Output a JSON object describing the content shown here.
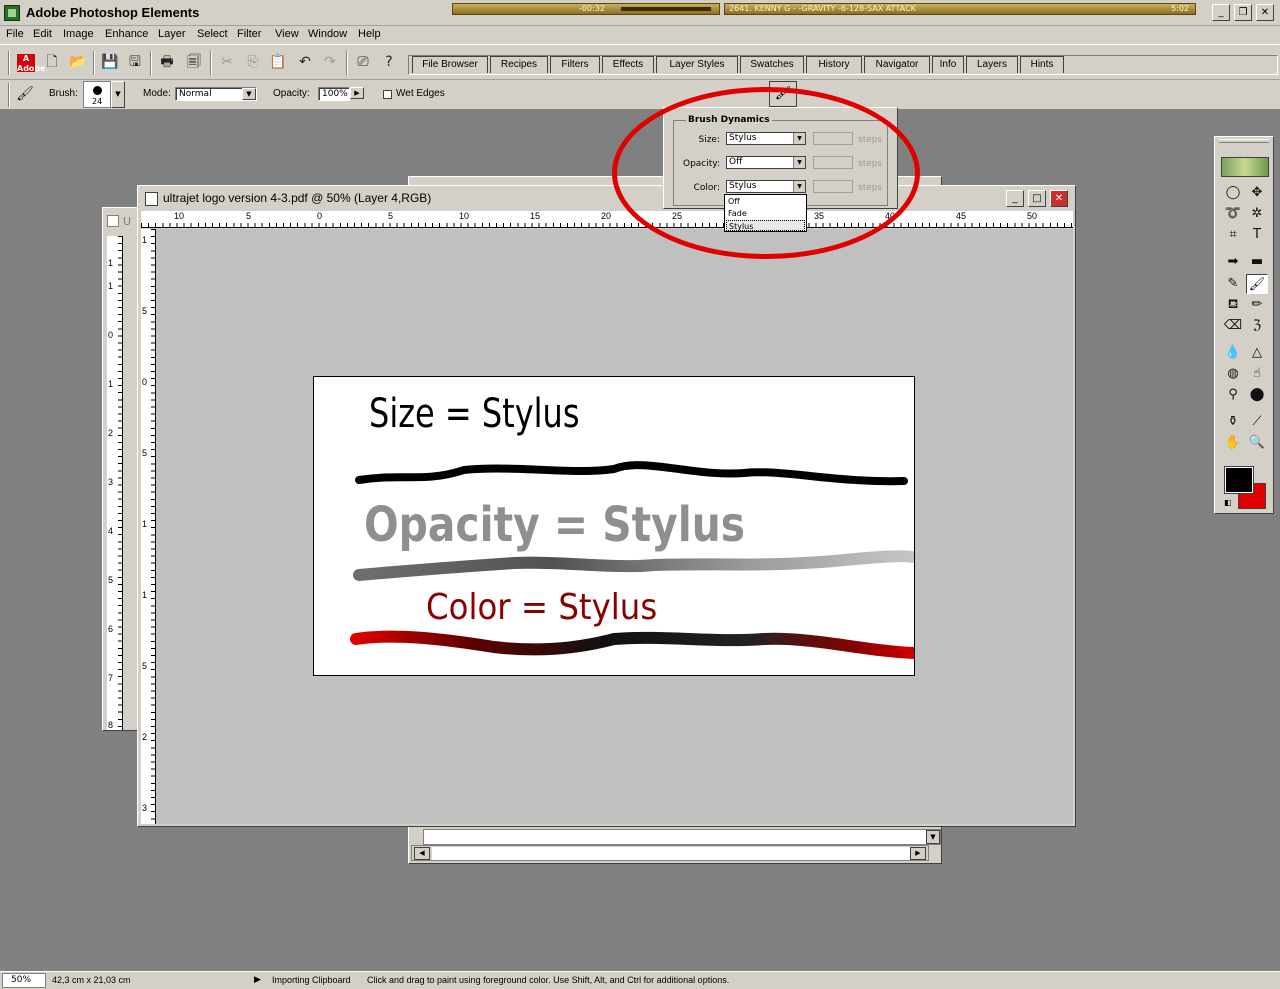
{
  "app": {
    "title": "Adobe Photoshop Elements"
  },
  "media": {
    "time": "-00:32",
    "track": "2641. KENNY G - -GRAVITY -6-128-SAX ATTACK",
    "clock": "5:02"
  },
  "menu": [
    "File",
    "Edit",
    "Image",
    "Enhance",
    "Layer",
    "Select",
    "Filter",
    "View",
    "Window",
    "Help"
  ],
  "palette_tabs": [
    "File Browser",
    "Recipes",
    "Filters",
    "Effects",
    "Layer Styles",
    "Swatches",
    "History",
    "Navigator",
    "Info",
    "Layers",
    "Hints"
  ],
  "options": {
    "brush_label": "Brush:",
    "brush_size": "24",
    "mode_label": "Mode:",
    "mode_value": "Normal",
    "opacity_label": "Opacity:",
    "opacity_value": "100%",
    "wet_edges_label": "Wet Edges"
  },
  "brush_dynamics": {
    "title": "Brush Dynamics",
    "size_label": "Size:",
    "size_value": "Stylus",
    "opacity_label": "Opacity:",
    "opacity_value": "Off",
    "color_label": "Color:",
    "color_value": "Stylus",
    "steps": "steps",
    "options": [
      "Off",
      "Fade",
      "Stylus"
    ]
  },
  "document": {
    "title": "ultrajet logo version 4-3.pdf @ 50% (Layer 4,RGB)",
    "h_ticks": [
      "10",
      "5",
      "0",
      "5",
      "10",
      "15",
      "20",
      "25",
      "30",
      "35",
      "40",
      "45",
      "50"
    ],
    "v_ticks": [
      "1",
      "5",
      "0",
      "5",
      "1",
      "1",
      "5",
      "2",
      "2",
      "5",
      "3"
    ],
    "back_v_ticks": [
      "1",
      "1",
      "0",
      "1",
      "2",
      "3",
      "4",
      "5",
      "6",
      "7",
      "8"
    ]
  },
  "canvas_text": {
    "line1": "Size = Stylus",
    "line2": "Opacity = Stylus",
    "line3": "Color = Stylus"
  },
  "status": {
    "zoom": "50%",
    "dimensions": "42,3 cm x 21,03 cm",
    "task": "Importing Clipboard",
    "hint": "Click and drag to paint using foreground color.  Use Shift, Alt, and Ctrl for additional options."
  },
  "colors": {
    "foreground": "#000000",
    "background": "#e00000",
    "annotation": "#e10000"
  }
}
